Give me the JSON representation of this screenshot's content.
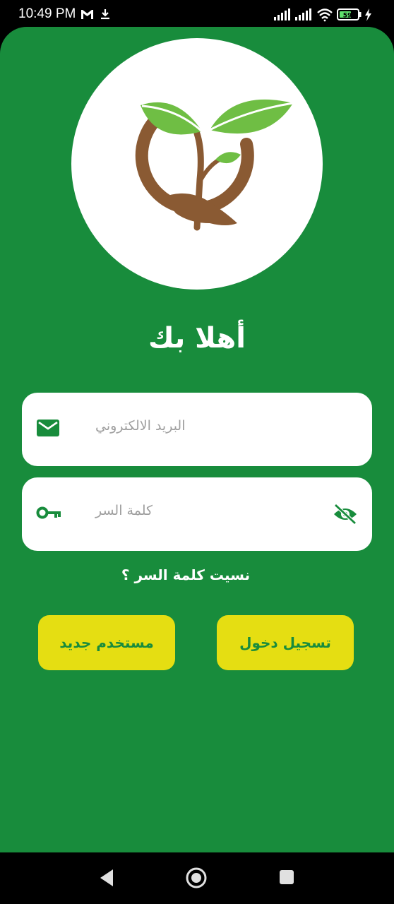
{
  "status_bar": {
    "time": "10:49 PM",
    "battery": "59",
    "icons": [
      "gmail-icon",
      "download-icon",
      "signal-icon",
      "signal-icon",
      "wifi-icon",
      "battery-icon",
      "charging-icon"
    ]
  },
  "colors": {
    "background": "#188c3c",
    "button": "#e5de12",
    "button_text": "#188c3c",
    "field_icon": "#188c3c"
  },
  "welcome": {
    "title": "أهلا بك"
  },
  "form": {
    "email_placeholder": "البريد الالكتروني",
    "password_placeholder": "كلمة السر",
    "forgot_password": "نسيت كلمة السر ؟"
  },
  "buttons": {
    "login": "تسجيل دخول",
    "new_user": "مستخدم جديد"
  },
  "nav": {
    "icons": [
      "back-icon",
      "home-icon",
      "recents-icon"
    ]
  }
}
